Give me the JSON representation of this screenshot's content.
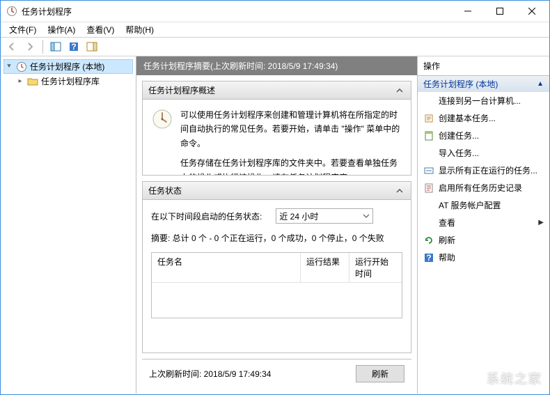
{
  "window": {
    "title": "任务计划程序"
  },
  "menu": {
    "file": "文件(F)",
    "action": "操作(A)",
    "view": "查看(V)",
    "help": "帮助(H)"
  },
  "tree": {
    "root": "任务计划程序 (本地)",
    "library": "任务计划程序库"
  },
  "center": {
    "summary_title": "任务计划程序摘要(上次刷新时间: 2018/5/9 17:49:34)",
    "overview_hdr": "任务计划程序概述",
    "overview_p1": "可以使用任务计划程序来创建和管理计算机将在所指定的时间自动执行的常见任务。若要开始，请单击 \"操作\" 菜单中的命令。",
    "overview_p2": "任务存储在任务计划程序库的文件夹中。若要查看单独任务上的操作或执行该操作，请在任务计划程序库",
    "status_hdr": "任务状态",
    "status_period_label": "在以下时间段启动的任务状态:",
    "status_period_value": "近 24 小时",
    "status_summary": "摘要: 总计 0 个 - 0 个正在运行，0 个成功，0 个停止，0 个失败",
    "col_name": "任务名",
    "col_result": "运行结果",
    "col_start": "运行开始时间",
    "last_refresh": "上次刷新时间: 2018/5/9 17:49:34",
    "refresh_btn": "刷新"
  },
  "actions": {
    "hdr": "操作",
    "category": "任务计划程序 (本地)",
    "items": {
      "connect": "连接到另一台计算机...",
      "create_basic": "创建基本任务...",
      "create_task": "创建任务...",
      "import": "导入任务...",
      "show_running": "显示所有正在运行的任务...",
      "enable_history": "启用所有任务历史记录",
      "at_service": "AT 服务帐户配置",
      "view": "查看",
      "refresh": "刷新",
      "help": "帮助"
    }
  },
  "watermark": "系统之家"
}
